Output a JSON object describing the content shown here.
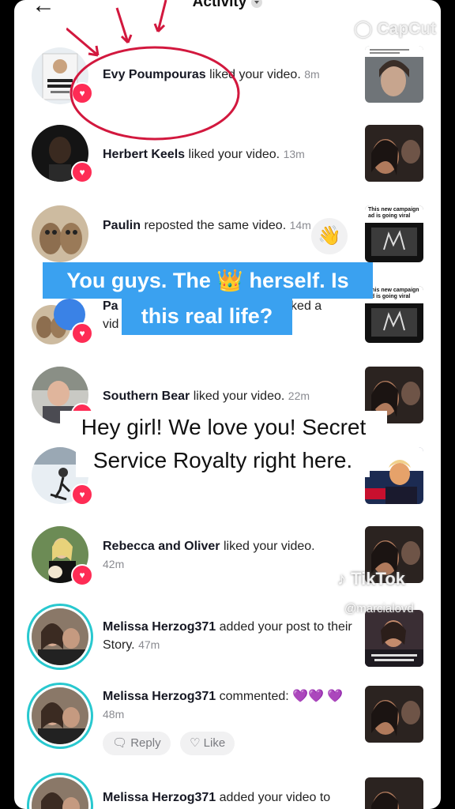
{
  "header": {
    "title": "Activity"
  },
  "watermarks": {
    "capcut": "CapCut",
    "tiktok": "TikTok",
    "handle": "@marcialovd"
  },
  "captions": {
    "blue_line1": "You guys. The 👑 herself. Is",
    "blue_line2": "this real life?",
    "white_line1": "Hey girl! We love you! Secret",
    "white_line2": "Service Royalty right here."
  },
  "notifications": [
    {
      "name": "Evy Poumpouras",
      "action": "liked your video.",
      "time": "8m"
    },
    {
      "name": "Herbert Keels",
      "action": "liked your video.",
      "time": "13m"
    },
    {
      "name": "Paulin",
      "action": "reposted the same video.",
      "time": "14m"
    },
    {
      "name": "Pa",
      "action": "s liked a",
      "extra": "vid"
    },
    {
      "name": "Southern Bear",
      "action": "liked your video.",
      "time": "22m"
    },
    {
      "name": "Rebecca and Oliver",
      "action": "liked your video.",
      "time": "42m"
    },
    {
      "name": "Melissa Herzog371",
      "action": "added your post to their Story.",
      "time": "47m"
    },
    {
      "name": "Melissa Herzog371",
      "action": "commented: 💜💜 💜",
      "time": "48m"
    },
    {
      "name": "Melissa Herzog371",
      "action": "added your video to"
    }
  ],
  "comment_actions": {
    "reply": "Reply",
    "like": "Like"
  },
  "thumb_texts": {
    "t3": "This new campaign ad is going viral"
  },
  "colors": {
    "heart_badge": "#fe2c55",
    "story_ring": "#28c8cf",
    "caption_blue": "#3aa1f0"
  }
}
